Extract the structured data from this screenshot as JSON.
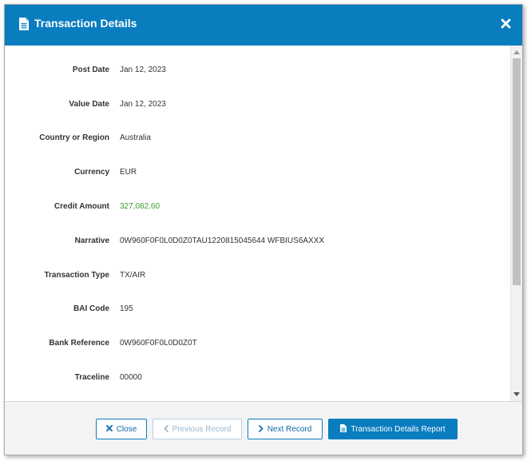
{
  "dialog": {
    "title": "Transaction Details",
    "header_icon": "document-icon",
    "close_icon": "close-icon",
    "accent_color": "#0a7dbf",
    "credit_color": "#3f9a2f"
  },
  "fields": [
    {
      "label": "Post Date",
      "value": "Jan 12, 2023"
    },
    {
      "label": "Value Date",
      "value": "Jan 12, 2023"
    },
    {
      "label": "Country or Region",
      "value": "Australia"
    },
    {
      "label": "Currency",
      "value": "EUR"
    },
    {
      "label": "Credit Amount",
      "value": "327,082.60"
    },
    {
      "label": "Narrative",
      "value": "0W960F0F0L0D0Z0TAU1220815045644 WFBIUS6AXXX"
    },
    {
      "label": "Transaction Type",
      "value": "TX/AIR"
    },
    {
      "label": "BAI Code",
      "value": "195"
    },
    {
      "label": "Bank Reference",
      "value": "0W960F0F0L0D0Z0T"
    },
    {
      "label": "Traceline",
      "value": "00000"
    }
  ],
  "footer": {
    "close_label": "Close",
    "previous_label": "Previous Record",
    "next_label": "Next Record",
    "report_label": "Transaction Details Report"
  }
}
